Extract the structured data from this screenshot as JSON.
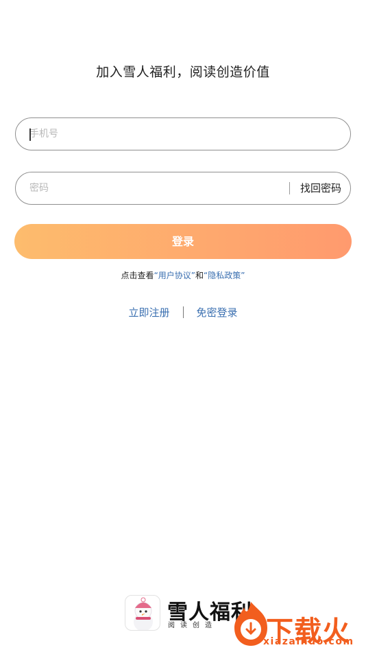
{
  "header": {
    "title": "加入雪人福利，阅读创造价值"
  },
  "form": {
    "phone_placeholder": "手机号",
    "phone_value": "",
    "password_placeholder": "密码",
    "password_value": "",
    "forgot_password_label": "找回密码",
    "login_label": "登录"
  },
  "agreement": {
    "prefix": "点击查看",
    "user_agreement": "“用户协议”",
    "and": "和",
    "privacy_policy": "“隐私政策”"
  },
  "links": {
    "register": "立即注册",
    "passwordless_login": "免密登录"
  },
  "brand": {
    "name": "雪人福利",
    "slogan": "阅读创造"
  },
  "watermark": {
    "text": "下载火",
    "url": "xiazaihuo.com"
  },
  "colors": {
    "accent_start": "#fdbc6d",
    "accent_end": "#ff9a6e",
    "link": "#3a6fb0",
    "watermark": "#f25e1e"
  },
  "icons": {
    "app_logo": "snowman-logo-icon",
    "watermark_logo": "download-flame-icon"
  }
}
